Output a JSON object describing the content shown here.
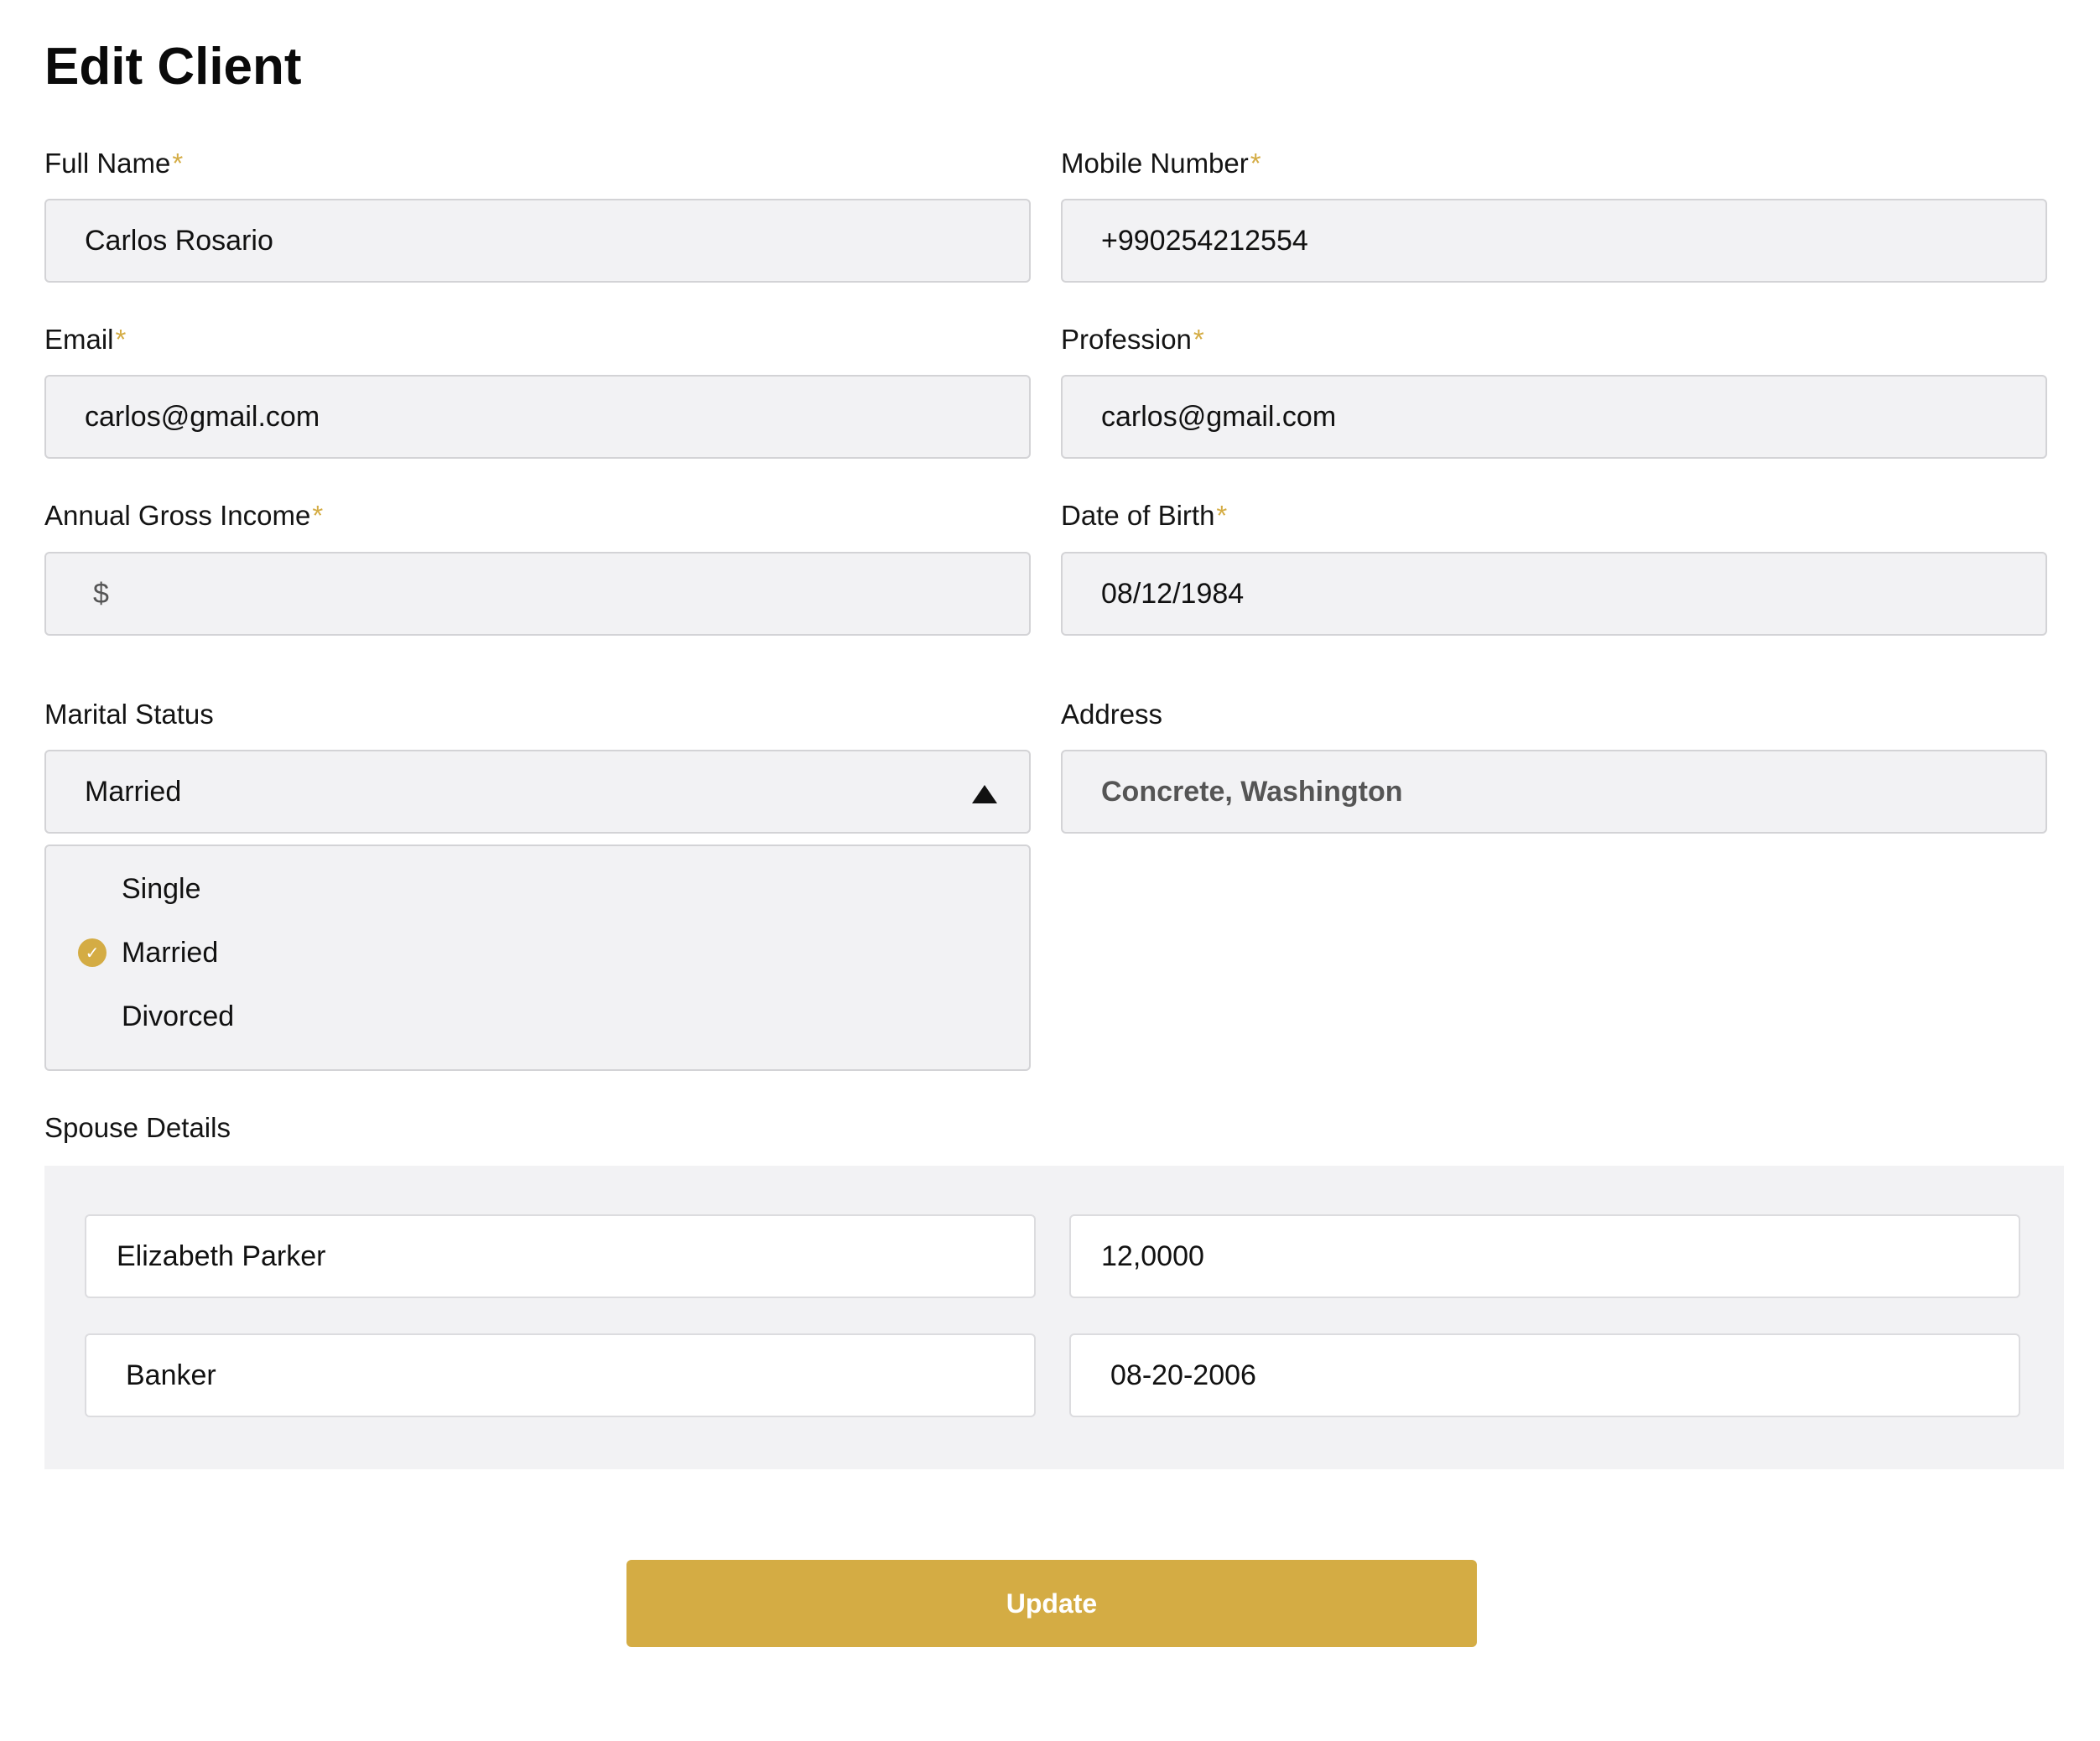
{
  "page": {
    "title": "Edit Client"
  },
  "required_marker": "*",
  "fields": {
    "full_name": {
      "label": "Full Name",
      "value": "Carlos Rosario"
    },
    "mobile_number": {
      "label": "Mobile Number",
      "value": "+990254212554"
    },
    "email": {
      "label": "Email",
      "value": "carlos@gmail.com"
    },
    "profession": {
      "label": "Profession",
      "value": "carlos@gmail.com"
    },
    "annual_gross_income": {
      "label": "Annual Gross Income",
      "prefix": "$",
      "value": ""
    },
    "date_of_birth": {
      "label": "Date of Birth",
      "value": "08/12/1984"
    },
    "marital_status": {
      "label": "Marital Status",
      "selected": "Married",
      "options": [
        "Single",
        "Married",
        "Divorced"
      ]
    },
    "address": {
      "label": "Address",
      "value": "Concrete, Washington"
    }
  },
  "spouse": {
    "label": "Spouse Details",
    "name": "Elizabeth Parker",
    "income": "12,0000",
    "profession": "Banker",
    "date_of_birth": "08-20-2006"
  },
  "actions": {
    "update_label": "Update"
  },
  "colors": {
    "accent": "#d4ac44",
    "field_bg": "#f2f2f4",
    "border": "#d3d3d6"
  }
}
